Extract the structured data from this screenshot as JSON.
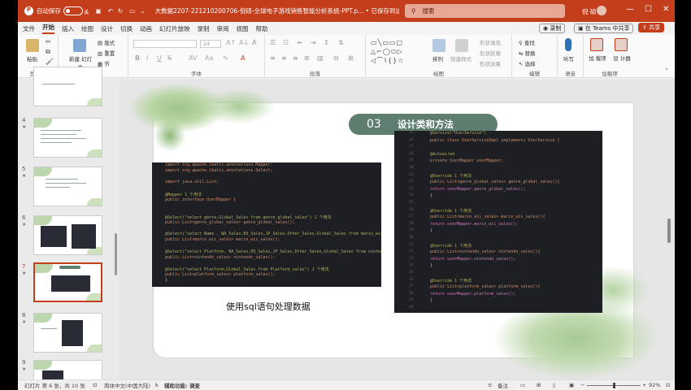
{
  "titlebar": {
    "autosave_label": "自动保存",
    "autosave_state": "关",
    "doc_title": "大数据2207-221210200706-倪硕-全球电子游戏销售智能分析系统-PPT.p... • 已保存到这台电脑",
    "search_placeholder": "搜索",
    "user_name": "倪 硕",
    "minimize": "—",
    "maximize": "☐",
    "close": "✕"
  },
  "tabs": [
    "文件",
    "开始",
    "插入",
    "绘图",
    "设计",
    "切换",
    "动画",
    "幻灯片放映",
    "录制",
    "审阅",
    "视图",
    "帮助"
  ],
  "active_tab": "开始",
  "right_buttons": {
    "record": "录制",
    "teams": "在 Teams 中共享",
    "share": "共享"
  },
  "ribbon": {
    "groups": [
      "剪贴板",
      "幻灯片",
      "字体",
      "段落",
      "绘图",
      "编辑",
      "语音",
      "加载项"
    ],
    "clipboard": {
      "paste": "粘贴"
    },
    "slides": {
      "new_slide": "新建 幻灯片",
      "layout": "版式",
      "reset": "重置",
      "section": "节"
    },
    "font": {
      "size": "24",
      "bold": "B",
      "italic": "I",
      "underline": "U",
      "strike": "S"
    },
    "drawing": {
      "arrange": "排列",
      "quick_styles": "快速样式",
      "shape_fill": "形状填充",
      "shape_outline": "形状轮廓",
      "shape_effects": "形状效果"
    },
    "editing": {
      "find": "查找",
      "replace": "替换",
      "select": "选择"
    },
    "voice": {
      "dictate": "听写"
    },
    "addins": {
      "addins": "加 载项",
      "designer": "设 计器"
    }
  },
  "thumbnails": [
    {
      "num": "",
      "star": "★"
    },
    {
      "num": "4",
      "star": "★"
    },
    {
      "num": "5",
      "star": "★"
    },
    {
      "num": "6",
      "star": "★"
    },
    {
      "num": "7",
      "star": "★"
    },
    {
      "num": "8",
      "star": "★"
    },
    {
      "num": "9",
      "star": "★"
    }
  ],
  "selected_thumbnail": "7",
  "slide": {
    "heading_num": "03",
    "heading_text": "设计类和方法",
    "caption": "使用sql语句处理数据",
    "left_code": [
      "import org.apache.ibatis.annotations.Mapper;",
      "import org.apache.ibatis.annotations.Select;",
      "",
      "import java.util.List;",
      "",
      "@Mapper  1 个用法",
      "public interface UserMapper {",
      "",
      "",
      "    @Select(\"select genre,Global_Sales from genre_global_sales\")  1 个用法",
      "    public List<genre_global_sales> genre_global_sales();",
      "",
      "    @Select(\"select Name , NA_Sales,EU_Sales,JP_Sales,Other_Sales,Global_Sales from  mario_wii_sales",
      "    public List<mario_wii_sales> mario_wii_sales();",
      "",
      "    @Select(\"select Platform, NA_Sales,EU_Sales,JP_Sales,Other_Sales,Global_Sales from  nintendo_sa",
      "    public List<nintendo_sales> nintendo_sales();",
      "",
      "    @Select(\"select Platform,Global_Sales from Platform_sales\")  1 个用法",
      "    public List<platform_sales> platform_sales();",
      "}"
    ],
    "right_code": [
      "@Service(\"UserService\")",
      "public class UserServiceImpl implements UserService {",
      "",
      "    @Autowired",
      "    private UserMapper userMapper;",
      "",
      "    @Override  1 个用法",
      "    public List<genre_global_sales> genre_global_sales(){",
      "        return userMapper.genre_global_sales();",
      "    }",
      "",
      "    @Override  1 个用法",
      "    public List<mario_wii_sales> mario_wii_sales(){",
      "        return userMapper.mario_wii_sales();",
      "    }",
      "",
      "    @Override  1 个用法",
      "    public List<nintendo_sales> nintendo_sales(){",
      "        return userMapper.nintendo_sales();",
      "    }",
      "",
      "    @Override  1 个用法",
      "    public List<platform_sales> platform_sales(){",
      "        return userMapper.platform_sales();",
      "    }"
    ],
    "right_line_numbers": [
      "15",
      "16",
      "17",
      "18",
      "19",
      "20",
      "21",
      "22",
      "23",
      "24",
      "25",
      "26",
      "27",
      "28",
      "29",
      "30",
      "31",
      "32",
      "33",
      "34",
      "35",
      "36",
      "37",
      "38",
      "39",
      "40"
    ]
  },
  "statusbar": {
    "slide_info": "幻灯片 第 6 张，共 10 张",
    "language": "简体中文(中国大陆)",
    "accessibility": "辅助功能: 调查",
    "notes": "备注",
    "zoom": "92%"
  },
  "colors": {
    "accent": "#c43e1c",
    "heading_pill": "#5e7f6f",
    "code_bg": "#1e1f22"
  }
}
